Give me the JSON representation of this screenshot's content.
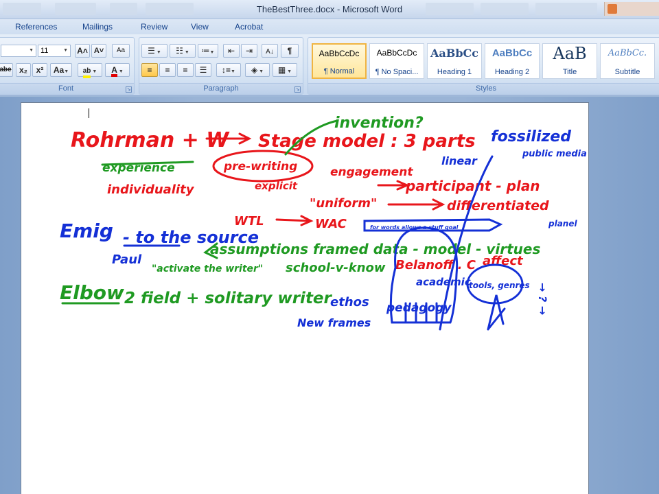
{
  "window": {
    "title": "TheBestThree.docx - Microsoft Word"
  },
  "ribbon_tabs": [
    "References",
    "Mailings",
    "Review",
    "View",
    "Acrobat"
  ],
  "font_group": {
    "size": "11",
    "label": "Font",
    "grow_label": "A˄",
    "shrink_label": "A˅",
    "strike_label": "abe",
    "subscript_label": "x₂",
    "superscript_label": "x²",
    "case_label": "Aa",
    "highlight_label": "ab₂",
    "font_color_label": "A"
  },
  "paragraph_group": {
    "label": "Paragraph"
  },
  "styles_group": {
    "label": "Styles",
    "styles": [
      {
        "sample": "AaBbCcDc",
        "name": "¶ Normal"
      },
      {
        "sample": "AaBbCcDc",
        "name": "¶ No Spaci..."
      },
      {
        "sample": "AaBbCc",
        "name": "Heading 1"
      },
      {
        "sample": "AaBbCc",
        "name": "Heading 2"
      },
      {
        "sample": "AaB",
        "name": "Title"
      },
      {
        "sample": "AaBbCc.",
        "name": "Subtitle"
      }
    ]
  },
  "colors": {
    "ink_red": "#e8161b",
    "ink_green": "#1f9a22",
    "ink_blue": "#1430d6",
    "highlight_yellow": "#ffef00",
    "font_color_red": "#e00000"
  },
  "ink_notes": {
    "red": {
      "line1": "Rohrman + W",
      "stage_model": "Stage model : 3 parts",
      "pre_writing": "pre-writing",
      "engagement": "engagement",
      "participant": "participant - plan",
      "uniform": "\"uniform\"",
      "differentiated": "differentiated",
      "individuality": "individuality",
      "explicit": "explicit",
      "wtl": "WTL",
      "wac": "WAC",
      "belanoff": "Belanoff . C",
      "affect": "affect"
    },
    "green": {
      "invention": "invention?",
      "experience": "experience",
      "assumptions": "assumptions framed data - model - virtues",
      "activate": "\"activate the writer\"",
      "school": "school-v-know",
      "elbow": "Elbow",
      "field": "2 field + solitary writer"
    },
    "blue": {
      "fossilized": "fossilized",
      "public_media": "public media",
      "linear": "linear",
      "emig": "Emig",
      "source": "- to the source",
      "paul": "Paul",
      "banner": "for words allows a stuff goal",
      "ethos": "ethos",
      "new_frames": "New frames",
      "pedagogy": "pedagogy",
      "academic": "academic",
      "tools": "tools, genres",
      "planel": "planel",
      "cycle": "→ ? →"
    }
  }
}
